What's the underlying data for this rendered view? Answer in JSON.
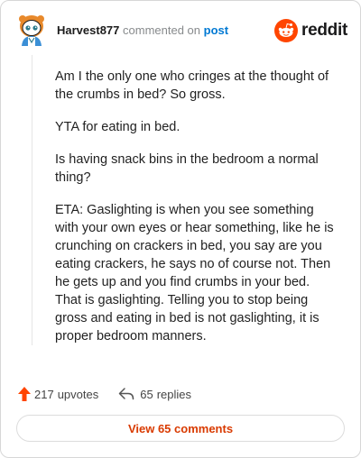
{
  "header": {
    "username": "Harvest877",
    "action_text": "commented on",
    "post_link": "post",
    "logo_text": "reddit"
  },
  "comment": {
    "paragraphs": [
      "Am I the only one who cringes at the thought of the crumbs in bed? So gross.",
      "YTA for eating in bed.",
      "Is having snack bins in the bedroom a normal thing?",
      "ETA: Gaslighting is when you see something with your own eyes or hear something, like he is crunching on crackers in bed, you say are you eating crackers, he says no of course not. Then he gets up and you find crumbs in your bed. That is gaslighting. Telling you to stop being gross and eating in bed is not gaslighting, it is proper bedroom manners."
    ]
  },
  "footer": {
    "upvotes_count": "217",
    "upvotes_label": "upvotes",
    "replies_count": "65",
    "replies_label": "replies",
    "view_comments_label": "View 65 comments"
  },
  "colors": {
    "reddit_orange": "#ff4500",
    "link_blue": "#0079d3",
    "view_button_text": "#d93a00"
  },
  "icons": {
    "avatar": "snoo-avatar",
    "logo": "reddit-alien-icon",
    "upvote": "upvote-arrow-icon",
    "reply": "reply-arrow-icon"
  }
}
